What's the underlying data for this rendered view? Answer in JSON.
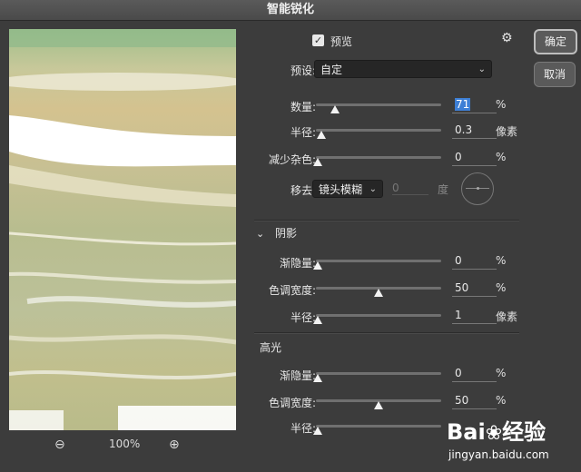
{
  "window": {
    "title": "智能锐化"
  },
  "zoom": {
    "level": "100%",
    "zoom_out_icon": "zoom-out-icon",
    "zoom_in_icon": "zoom-in-icon"
  },
  "preview_toggle": {
    "label": "预览",
    "checked": true
  },
  "buttons": {
    "ok": "确定",
    "cancel": "取消"
  },
  "preset": {
    "label": "预设:",
    "value": "自定"
  },
  "main": {
    "amount": {
      "label": "数量:",
      "value": "71",
      "unit": "%",
      "level": 0.14
    },
    "radius": {
      "label": "半径:",
      "value": "0.3",
      "unit": "像素",
      "level": 0.03
    },
    "noise": {
      "label": "减少杂色:",
      "value": "0",
      "unit": "%",
      "level": 0.0
    }
  },
  "remove": {
    "label": "移去:",
    "value": "镜头模糊",
    "angle_value": "0",
    "angle_unit": "度"
  },
  "shadows": {
    "title": "阴影",
    "fade": {
      "label": "渐隐量:",
      "value": "0",
      "unit": "%",
      "level": 0.0
    },
    "tonal": {
      "label": "色调宽度:",
      "value": "50",
      "unit": "%",
      "level": 0.5
    },
    "radius": {
      "label": "半径:",
      "value": "1",
      "unit": "像素",
      "level": 0.0
    }
  },
  "highlights": {
    "title": "高光",
    "fade": {
      "label": "渐隐量:",
      "value": "0",
      "unit": "%",
      "level": 0.0
    },
    "tonal": {
      "label": "色调宽度:",
      "value": "50",
      "unit": "%",
      "level": 0.5
    },
    "radius": {
      "label": "半径:",
      "value": "",
      "unit": "",
      "level": 0.0
    }
  },
  "watermark": {
    "brand": "Bai",
    "brand2": "经验",
    "url": "jingyan.baidu.com"
  }
}
